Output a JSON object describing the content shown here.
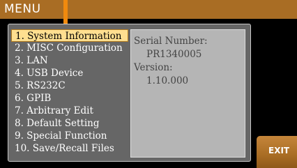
{
  "header": {
    "title": "MENU"
  },
  "menu": {
    "items": [
      {
        "label": "1. System Information",
        "selected": true
      },
      {
        "label": "2. MISC Configuration",
        "selected": false
      },
      {
        "label": "3. LAN",
        "selected": false
      },
      {
        "label": "4. USB Device",
        "selected": false
      },
      {
        "label": "5. RS232C",
        "selected": false
      },
      {
        "label": "6. GPIB",
        "selected": false
      },
      {
        "label": "7. Arbitrary Edit",
        "selected": false
      },
      {
        "label": "8. Default Setting",
        "selected": false
      },
      {
        "label": "9. Special Function",
        "selected": false
      },
      {
        "label": "10. Save/Recall Files",
        "selected": false
      }
    ]
  },
  "info": {
    "serial_label": "Serial Number:",
    "serial_value": "PR1340005",
    "version_label": "Version:",
    "version_value": "1.10.000"
  },
  "softkeys": {
    "exit_label": "EXIT"
  },
  "colors": {
    "accent": "#a96d24",
    "selection": "#ffdf90",
    "pointer": "#f08a0e"
  }
}
